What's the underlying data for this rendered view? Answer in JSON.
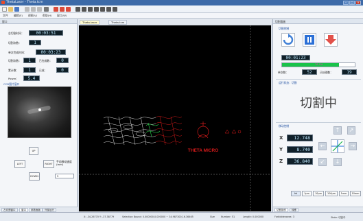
{
  "window": {
    "title": "ThetaLaser - Theta.tcm"
  },
  "menu": [
    "文件",
    "编辑(E)",
    "视图(V)",
    "帮助(H)",
    "窗口(W)"
  ],
  "left_panel": {
    "title": "窗口",
    "rows": {
      "total_time_label": "总切割时间：",
      "total_time": "00:03:51",
      "cut_count_label": "切割次数：",
      "cut_count": "1",
      "single_time_label": "单次完成时间：",
      "single_time": "00:03:23",
      "cut_times_label": "切割次数：",
      "cut_times": "1",
      "done_label": "已完成数：",
      "done": "0",
      "total_done_label": "累计数：",
      "total_done": "1",
      "finished_label": "已成：",
      "finished": "0",
      "power_label": "Power：",
      "power": "5.4"
    },
    "camera_title": "CCD图片窗口",
    "buttons": {
      "up": "UP",
      "left": "LEFT",
      "right": "RIGHT",
      "down": "DOWN"
    },
    "speed_label": "手动移动速度(mm)",
    "speed_value": "5",
    "bottom_tabs": [
      "左切割窗口",
      "窗口",
      "参数面板",
      "外部运行"
    ]
  },
  "canvas": {
    "tabs": [
      "Theta.laser",
      "Theta.tcm"
    ],
    "text_label": "THETA MICRO"
  },
  "right_panel": {
    "title": "切割面板",
    "control_group": "切割控制",
    "elapsed": "00:01:23",
    "progress_pct": 78,
    "progress_text": "78.0%",
    "single_count_label": "单次数：",
    "single_count": "52",
    "done_count_label": "已处理数：",
    "done_count": "19",
    "status_group": "运行状态：切割",
    "status_text": "切割中",
    "motion_group": "移动控制",
    "coords": {
      "x_label": "X",
      "x": "12.748",
      "y_label": "Y",
      "y": "8.740",
      "z_label": "Z",
      "z": "36.840"
    },
    "steps": [
      "fst",
      "1μm",
      "10μm",
      "100μm",
      "1mm",
      "10mm"
    ],
    "bottom_tabs": [
      "切割操作",
      "转移"
    ]
  },
  "statusbar": {
    "cursor": "X: -34.26770   Y: -37.38779",
    "selection": "Selection Bound: 0.000000,0.000000 ~ 34.987300,16.36465",
    "size": "Size",
    "number": "Number: 51",
    "length": "Length: 0.000000",
    "field3": "Forbiddenarea: 3",
    "state": "State: 切割中"
  }
}
